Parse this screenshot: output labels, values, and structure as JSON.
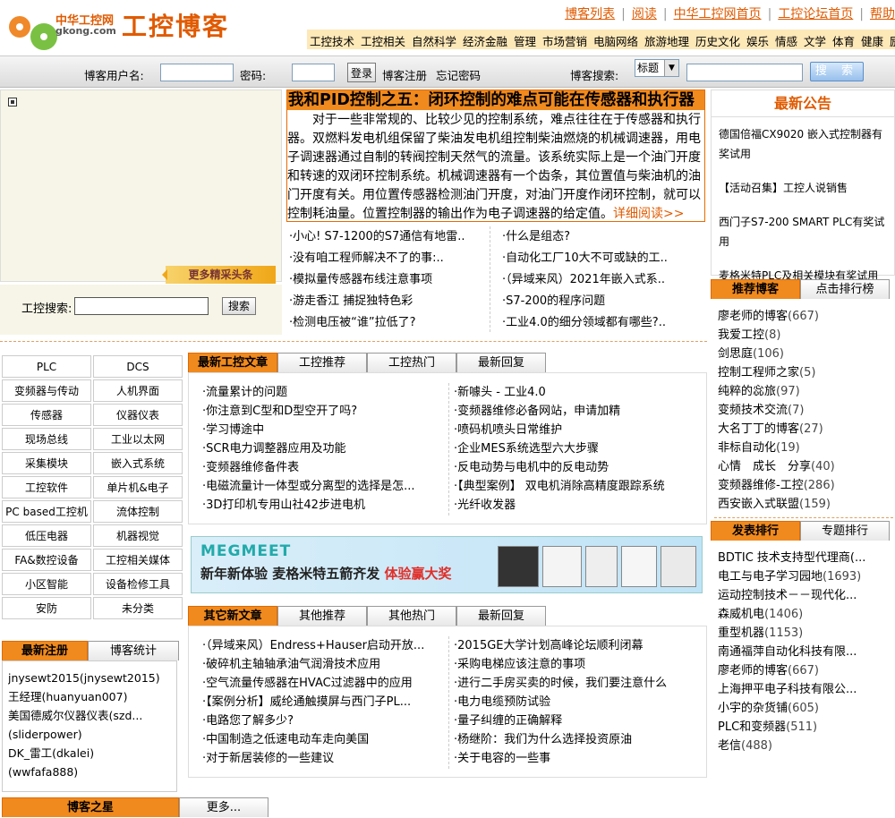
{
  "header": {
    "logo_cn": "中华工控网",
    "logo_en": "gkong.com",
    "logo_title": "工控博客",
    "top_links": [
      "博客列表",
      "阅读",
      "中华工控网首页",
      "工控论坛首页",
      "帮助"
    ],
    "categories": [
      "工控技术",
      "工控相关",
      "自然科学",
      "经济金融",
      "管理",
      "市场营销",
      "电脑网络",
      "旅游地理",
      "历史文化",
      "娱乐",
      "情感",
      "文学",
      "体育",
      "健康",
      "励志"
    ]
  },
  "login": {
    "username_label": "博客用户名:",
    "password_label": "密码:",
    "login_button": "登录",
    "register_link": "博客注册",
    "forgot_link": "忘记密码",
    "search_label": "博客搜索:",
    "search_type": "标题",
    "search_button": "搜 索"
  },
  "flash": {
    "more_headlines": "更多精采头条"
  },
  "gk_search": {
    "label": "工控搜索:",
    "button": "搜索"
  },
  "headline": {
    "title": "我和PID控制之五：闭环控制的难点可能在传感器和执行器",
    "body": "对于一些非常规的、比较少见的控制系统，难点往往在于传感器和执行器。双燃料发电机组保留了柴油发电机组控制柴油燃烧的机械调速器，用电子调速器通过自制的转阀控制天然气的流量。该系统实际上是一个油门开度和转速的双闭环控制系统。机械调速器有一个齿条，其位置值与柴油机的油门开度有关。用位置传感器检测油门开度，对油门开度作闭环控制，就可以控制耗油量。位置控制器的输出作为电子调速器的给定值。",
    "more": "详细阅读>>",
    "left_items": [
      "·小心! S7-1200的S7通信有地雷..",
      "·没有咱工程师解决不了的事:..",
      "·模拟量传感器布线注意事项",
      "·游走香江 捕捉独特色彩",
      "·检测电压被“谁”拉低了?"
    ],
    "right_items": [
      "·什么是组态?",
      "·自动化工厂10大不可或缺的工..",
      "·（异域来风）2021年嵌入式系..",
      "·S7-200的程序问题",
      "·工业4.0的细分领域都有哪些?.."
    ]
  },
  "announcements": {
    "title": "最新公告",
    "items": [
      "德国倍福CX9020 嵌入式控制器有奖试用",
      "【活动召集】工控人说销售",
      "西门子S7-200 SMART PLC有奖试用",
      "麦格米特PLC及相关模块有奖试用"
    ]
  },
  "recommend": {
    "tabs": [
      "推荐博客",
      "点击排行榜"
    ],
    "items": [
      {
        "name": "廖老师的博客",
        "count": "(667)"
      },
      {
        "name": "我爱工控",
        "count": "(8)"
      },
      {
        "name": "剑思庭",
        "count": "(106)"
      },
      {
        "name": "控制工程师之家",
        "count": "(5)"
      },
      {
        "name": "纯粹的惢旅",
        "count": "(97)"
      },
      {
        "name": "变频技术交流",
        "count": "(7)"
      },
      {
        "name": "大名丁丁的博客",
        "count": "(27)"
      },
      {
        "name": "非标自动化",
        "count": "(19)"
      },
      {
        "name": "心情　成长　分享",
        "count": "(40)"
      },
      {
        "name": "变频器维修-工控",
        "count": "(286)"
      },
      {
        "name": "西安嵌入式联盟",
        "count": "(159)"
      }
    ]
  },
  "publish": {
    "tabs": [
      "发表排行",
      "专题排行"
    ],
    "items": [
      {
        "name": "BDTIC 技术支持型代理商(...",
        "count": ""
      },
      {
        "name": "电工与电子学习园地",
        "count": "(1693)"
      },
      {
        "name": "运动控制技术－－现代化...",
        "count": ""
      },
      {
        "name": "森威机电",
        "count": "(1406)"
      },
      {
        "name": "重型机器",
        "count": "(1153)"
      },
      {
        "name": "南通福萍自动化科技有限...",
        "count": ""
      },
      {
        "name": "廖老师的博客",
        "count": "(667)"
      },
      {
        "name": "上海押平电子科技有限公...",
        "count": ""
      },
      {
        "name": "小宇的杂货铺",
        "count": "(605)"
      },
      {
        "name": "PLC和变频器",
        "count": "(511)"
      },
      {
        "name": "老信",
        "count": "(488)"
      }
    ]
  },
  "cats": [
    "PLC",
    "DCS",
    "变频器与传动",
    "人机界面",
    "传感器",
    "仪器仪表",
    "现场总线",
    "工业以太网",
    "采集模块",
    "嵌入式系统",
    "工控软件",
    "单片机&电子",
    "PC based工控机",
    "流体控制",
    "低压电器",
    "机器视觉",
    "FA&数控设备",
    "工控相关媒体",
    "小区智能",
    "设备检修工具",
    "安防",
    "未分类"
  ],
  "section1": {
    "tabs": [
      "最新工控文章",
      "工控推荐",
      "工控热门",
      "最新回复"
    ],
    "left": [
      "·流量累计的问题",
      "·你注意到C型和D型空开了吗?",
      "·学习博途中",
      "·SCR电力调整器应用及功能",
      "·变频器维修备件表",
      "·电磁流量计一体型或分离型的选择是怎...",
      "·3D打印机专用山社42步进电机"
    ],
    "right": [
      "·新噱头 - 工业4.0",
      "·变频器维修必备网站，申请加精",
      "·喷码机喷头日常维护",
      "·企业MES系统选型六大步骤",
      "·反电动势与电机中的反电动势",
      "·【典型案例】 双电机消除高精度跟踪系统",
      "·光纤收发器"
    ]
  },
  "banner": {
    "brand": "MEGMEET",
    "slogan": "新年新体验 麦格米特五箭齐发",
    "slogan_hl": "体验赢大奖"
  },
  "section2": {
    "tabs": [
      "其它新文章",
      "其他推荐",
      "其他热门",
      "最新回复"
    ],
    "left": [
      "·（异域来风）Endress+Hauser启动开放...",
      "·破碎机主轴轴承油气润滑技术应用",
      "·空气流量传感器在HVAC过滤器中的应用",
      "·【案例分析】威纶通触摸屏与西门子PL...",
      "·电路您了解多少?",
      "·中国制造之低速电动车走向美国",
      "·对于新居装修的一些建议"
    ],
    "right": [
      "·2015GE大学计划高峰论坛顺利闭幕",
      "·采购电梯应该注意的事项",
      "·进行二手房买卖的时候，我们要注意什么",
      "·电力电缆预防试验",
      "·量子纠缠的正确解释",
      "·杨继阶：我们为什么选择投资原油",
      "·关于电容的一些事"
    ]
  },
  "register": {
    "tabs": [
      "最新注册",
      "博客统计"
    ],
    "items": [
      "jnysewt2015(jnysewt2015)",
      "王经理(huanyuan007)",
      "美国德威尔仪器仪表(szd...",
      "(sliderpower)",
      "DK_雷工(dkalei)",
      "(wwfafa888)"
    ]
  },
  "stars": {
    "tabs": [
      "博客之星",
      "更多..."
    ]
  }
}
